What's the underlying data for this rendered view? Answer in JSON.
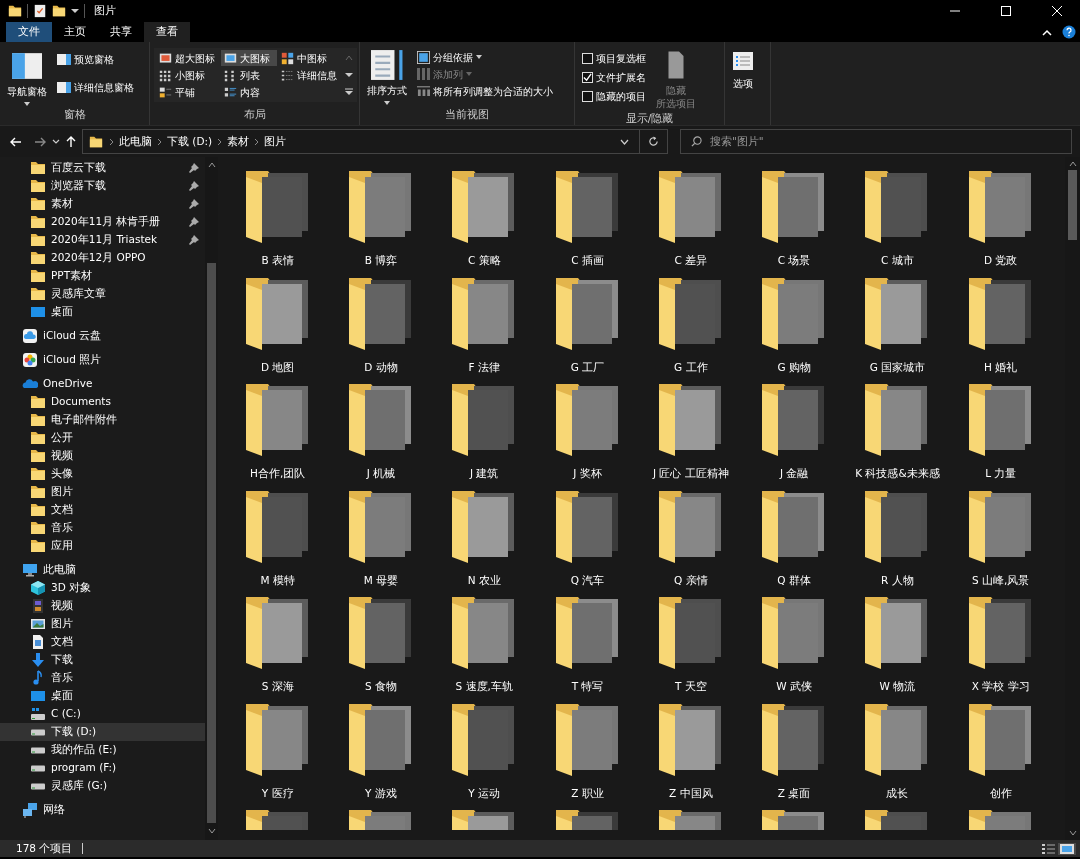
{
  "window": {
    "title": "图片"
  },
  "ribbon_tabs": [
    {
      "label": "文件",
      "kind": "file",
      "selected": false
    },
    {
      "label": "主页",
      "kind": "tab",
      "selected": false
    },
    {
      "label": "共享",
      "kind": "tab",
      "selected": false
    },
    {
      "label": "查看",
      "kind": "tab",
      "selected": true
    }
  ],
  "panes_group": {
    "title": "窗格",
    "nav_pane": "导航窗格",
    "preview_pane": "预览窗格",
    "details_pane": "详细信息窗格"
  },
  "layout_group": {
    "title": "布局",
    "options": [
      {
        "label": "超大图标",
        "kind": "xl",
        "selected": false
      },
      {
        "label": "大图标",
        "kind": "large",
        "selected": true
      },
      {
        "label": "中图标",
        "kind": "medium",
        "selected": false
      },
      {
        "label": "小图标",
        "kind": "small",
        "selected": false
      },
      {
        "label": "列表",
        "kind": "list",
        "selected": false
      },
      {
        "label": "详细信息",
        "kind": "details",
        "selected": false
      },
      {
        "label": "平铺",
        "kind": "tiles",
        "selected": false
      },
      {
        "label": "内容",
        "kind": "content",
        "selected": false
      }
    ]
  },
  "current_view_group": {
    "title": "当前视图",
    "sort": "排序方式",
    "group_by": "分组依据",
    "add_column": {
      "label": "添加列",
      "disabled": true
    },
    "fit_columns": "将所有列调整为合适的大小"
  },
  "show_hide_group": {
    "title": "显示/隐藏",
    "checkboxes": [
      {
        "label": "项目复选框",
        "checked": false
      },
      {
        "label": "文件扩展名",
        "checked": true
      },
      {
        "label": "隐藏的项目",
        "checked": false
      }
    ],
    "hide_selected": [
      "隐藏",
      "所选项目"
    ]
  },
  "options_button": "选项",
  "address_bar": {
    "crumbs": [
      "此电脑",
      "下载 (D:)",
      "素材",
      "图片"
    ]
  },
  "search": {
    "placeholder": "搜索\"图片\""
  },
  "sidebar": {
    "quick_access_items": [
      {
        "label": "百度云下载",
        "kind": "folder",
        "pinned": true,
        "selected": false
      },
      {
        "label": "浏览器下载",
        "kind": "folder",
        "pinned": true,
        "selected": false
      },
      {
        "label": "素材",
        "kind": "folder",
        "pinned": true,
        "selected": false
      },
      {
        "label": "2020年11月 林肯手册",
        "kind": "folder",
        "pinned": true,
        "selected": false
      },
      {
        "label": "2020年11月 Triastek",
        "kind": "folder",
        "pinned": true,
        "selected": false
      },
      {
        "label": "2020年12月 OPPO",
        "kind": "folder",
        "pinned": false,
        "selected": false
      },
      {
        "label": "PPT素材",
        "kind": "folder",
        "pinned": false,
        "selected": false
      },
      {
        "label": "灵感库文章",
        "kind": "folder",
        "pinned": false,
        "selected": false
      },
      {
        "label": "桌面",
        "kind": "desktop",
        "pinned": false,
        "selected": false
      }
    ],
    "roots": [
      {
        "label": "iCloud 云盘",
        "kind": "icloud",
        "selected": false
      },
      {
        "label": "iCloud 照片",
        "kind": "photos",
        "selected": false
      },
      {
        "label": "OneDrive",
        "kind": "onedrive",
        "selected": false,
        "children": [
          {
            "label": "Documents",
            "kind": "folder",
            "selected": false
          },
          {
            "label": "电子邮件附件",
            "kind": "folder",
            "selected": false
          },
          {
            "label": "公开",
            "kind": "folder",
            "selected": false
          },
          {
            "label": "视频",
            "kind": "folder",
            "selected": false
          },
          {
            "label": "头像",
            "kind": "folder",
            "selected": false
          },
          {
            "label": "图片",
            "kind": "folder",
            "selected": false
          },
          {
            "label": "文档",
            "kind": "folder",
            "selected": false
          },
          {
            "label": "音乐",
            "kind": "folder",
            "selected": false
          },
          {
            "label": "应用",
            "kind": "folder",
            "selected": false
          }
        ]
      },
      {
        "label": "此电脑",
        "kind": "pc",
        "selected": false,
        "children": [
          {
            "label": "3D 对象",
            "kind": "cube",
            "selected": false
          },
          {
            "label": "视频",
            "kind": "film",
            "selected": false
          },
          {
            "label": "图片",
            "kind": "picture",
            "selected": false
          },
          {
            "label": "文档",
            "kind": "document",
            "selected": false
          },
          {
            "label": "下载",
            "kind": "download",
            "selected": false
          },
          {
            "label": "音乐",
            "kind": "music",
            "selected": false
          },
          {
            "label": "桌面",
            "kind": "desktop",
            "selected": false
          },
          {
            "label": "C (C:)",
            "kind": "system-drive",
            "selected": false
          },
          {
            "label": "下载 (D:)",
            "kind": "drive",
            "selected": true
          },
          {
            "label": "我的作品 (E:)",
            "kind": "drive",
            "selected": false
          },
          {
            "label": "program (F:)",
            "kind": "drive",
            "selected": false
          },
          {
            "label": "灵感库 (G:)",
            "kind": "drive",
            "selected": false
          }
        ]
      },
      {
        "label": "网络",
        "kind": "network",
        "selected": false
      }
    ]
  },
  "folders": [
    {
      "kind": "folder",
      "name": "B 表情"
    },
    {
      "kind": "folder",
      "name": "B 博弈"
    },
    {
      "kind": "folder",
      "name": "C 策略"
    },
    {
      "kind": "folder",
      "name": "C 插画"
    },
    {
      "kind": "folder",
      "name": "C 差异"
    },
    {
      "kind": "folder",
      "name": "C 场景"
    },
    {
      "kind": "folder",
      "name": "C 城市"
    },
    {
      "kind": "folder",
      "name": "D 党政"
    },
    {
      "kind": "folder",
      "name": "D 地图"
    },
    {
      "kind": "folder",
      "name": "D 动物"
    },
    {
      "kind": "folder",
      "name": "F 法律"
    },
    {
      "kind": "folder",
      "name": "G 工厂"
    },
    {
      "kind": "folder",
      "name": "G 工作"
    },
    {
      "kind": "folder",
      "name": "G 购物"
    },
    {
      "kind": "folder",
      "name": "G 国家城市"
    },
    {
      "kind": "folder",
      "name": "H 婚礼"
    },
    {
      "kind": "folder",
      "name": "H合作,团队"
    },
    {
      "kind": "folder",
      "name": "J 机械"
    },
    {
      "kind": "folder",
      "name": "J 建筑"
    },
    {
      "kind": "folder",
      "name": "J 奖杯"
    },
    {
      "kind": "folder",
      "name": "J 匠心 工匠精神"
    },
    {
      "kind": "folder",
      "name": "J 金融"
    },
    {
      "kind": "folder",
      "name": "K 科技感&未来感"
    },
    {
      "kind": "folder",
      "name": "L 力量"
    },
    {
      "kind": "folder",
      "name": "M 模特"
    },
    {
      "kind": "folder",
      "name": "M 母婴"
    },
    {
      "kind": "folder",
      "name": "N 农业"
    },
    {
      "kind": "folder",
      "name": "Q 汽车"
    },
    {
      "kind": "folder",
      "name": "Q 亲情"
    },
    {
      "kind": "folder",
      "name": "Q 群体"
    },
    {
      "kind": "folder",
      "name": "R 人物"
    },
    {
      "kind": "folder",
      "name": "S 山峰,风景"
    },
    {
      "kind": "folder",
      "name": "S 深海"
    },
    {
      "kind": "folder",
      "name": "S 食物"
    },
    {
      "kind": "folder",
      "name": "S 速度,车轨"
    },
    {
      "kind": "folder",
      "name": "T 特写"
    },
    {
      "kind": "folder",
      "name": "T 天空"
    },
    {
      "kind": "folder",
      "name": "W 武侠"
    },
    {
      "kind": "folder",
      "name": "W 物流"
    },
    {
      "kind": "folder",
      "name": "X 学校 学习"
    },
    {
      "kind": "folder",
      "name": "Y 医疗"
    },
    {
      "kind": "folder",
      "name": "Y 游戏"
    },
    {
      "kind": "folder",
      "name": "Y 运动"
    },
    {
      "kind": "folder",
      "name": "Z 职业"
    },
    {
      "kind": "folder",
      "name": "Z 中国风"
    },
    {
      "kind": "folder",
      "name": "Z 桌面"
    },
    {
      "kind": "folder",
      "name": "成长"
    },
    {
      "kind": "folder",
      "name": "创作"
    },
    {
      "kind": "cut-off"
    },
    {
      "kind": "cut-off"
    },
    {
      "kind": "cut-off"
    },
    {
      "kind": "cut-off"
    },
    {
      "kind": "cut-off"
    },
    {
      "kind": "cut-off"
    },
    {
      "kind": "cut-off"
    },
    {
      "kind": "cut-off"
    }
  ],
  "status_bar": {
    "item_count": "178 个项目",
    "view_toggles": [
      {
        "kind": "details",
        "selected": false
      },
      {
        "kind": "large-icons",
        "selected": true
      }
    ]
  }
}
